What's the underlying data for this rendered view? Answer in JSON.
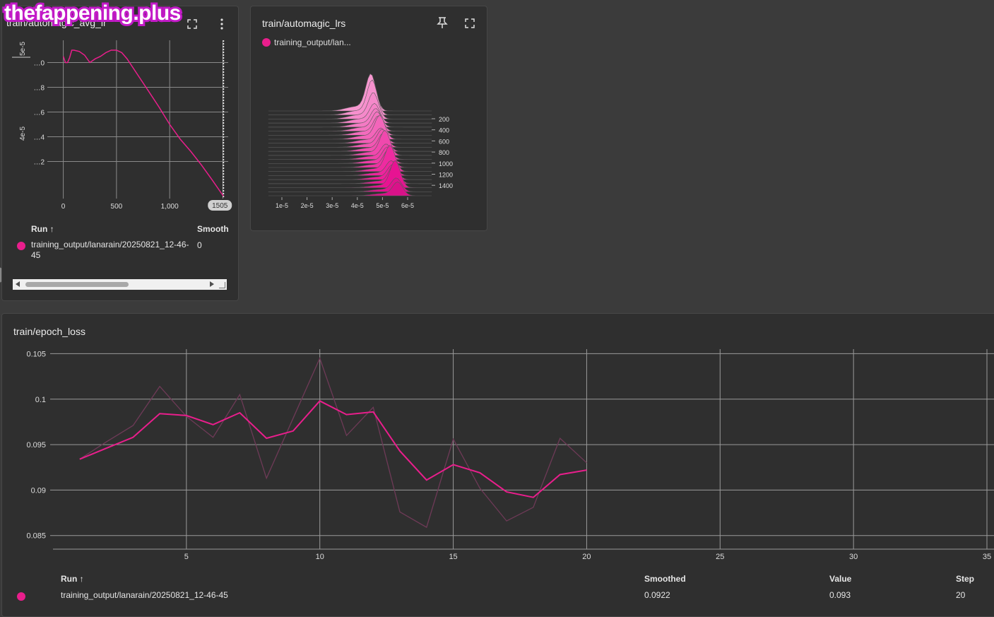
{
  "watermark": "thefappening.plus",
  "card1": {
    "title": "train/automagic_avg_lr",
    "y_exponent_top": "5e-5",
    "y_exponent_mid": "4e-5",
    "y_ticks": [
      "0",
      "8",
      "6",
      "4",
      "2"
    ],
    "x_ticks": [
      "0",
      "500",
      "1,000"
    ],
    "hover_step": "1505",
    "table": {
      "col_run": "Run ↑",
      "col_smoothed": "Smooth",
      "run_name": "training_output/lanarain/20250821_12-46-45",
      "smoothed": "0"
    }
  },
  "card2": {
    "title": "train/automagic_lrs",
    "legend": "training_output/lan...",
    "x_ticks": [
      "1e-5",
      "2e-5",
      "3e-5",
      "4e-5",
      "5e-5",
      "6e-5"
    ],
    "step_ticks": [
      "200",
      "400",
      "600",
      "800",
      "1000",
      "1200",
      "1400"
    ]
  },
  "card3": {
    "title": "train/epoch_loss",
    "table": {
      "col_run": "Run ↑",
      "col_smoothed": "Smoothed",
      "col_value": "Value",
      "col_step": "Step",
      "run_name": "training_output/lanarain/20250821_12-46-45",
      "smoothed": "0.0922",
      "value": "0.093",
      "step": "20"
    }
  },
  "colors": {
    "accent": "#e91e8c",
    "card_bg": "#2f2f2f",
    "page_bg": "#3b3b3b"
  },
  "chart_data": [
    {
      "type": "line",
      "title": "train/automagic_avg_lr",
      "x": [
        0,
        20,
        40,
        60,
        80,
        100,
        150,
        200,
        250,
        300,
        350,
        400,
        450,
        500,
        550,
        600,
        700,
        800,
        900,
        1000,
        1100,
        1200,
        1300,
        1400,
        1505
      ],
      "series": [
        {
          "values": [
            5.05e-05,
            5e-05,
            5e-05,
            5.04e-05,
            5.1e-05,
            5.1e-05,
            5.09e-05,
            5.06e-05,
            5e-05,
            5.03e-05,
            5.05e-05,
            5.08e-05,
            5.1e-05,
            5.1e-05,
            5.08e-05,
            5.03e-05,
            4.9e-05,
            4.77e-05,
            4.64e-05,
            4.5e-05,
            4.38e-05,
            4.28e-05,
            4.17e-05,
            4.05e-05,
            3.92e-05
          ]
        }
      ],
      "xlim": [
        -150,
        1550
      ],
      "ylim": [
        3.9e-05,
        5.18e-05
      ]
    },
    {
      "type": "area",
      "title": "train/automagic_lrs",
      "x_ticks": [
        "1e-5",
        "2e-5",
        "3e-5",
        "4e-5",
        "5e-5",
        "6e-5"
      ],
      "steps": [
        200,
        400,
        600,
        800,
        1000,
        1200,
        1400
      ]
    },
    {
      "type": "line",
      "title": "train/epoch_loss",
      "x": [
        1,
        2,
        3,
        4,
        5,
        6,
        7,
        8,
        9,
        10,
        11,
        12,
        13,
        14,
        15,
        16,
        17,
        18,
        19,
        20
      ],
      "series": [
        {
          "name": "Smoothed",
          "values": [
            0.0934,
            0.0946,
            0.0958,
            0.0984,
            0.0982,
            0.0972,
            0.0985,
            0.0957,
            0.0965,
            0.0998,
            0.0983,
            0.0986,
            0.0943,
            0.0911,
            0.0928,
            0.0919,
            0.0898,
            0.0892,
            0.0917,
            0.0922
          ]
        },
        {
          "name": "Value",
          "values": [
            0.0934,
            0.0953,
            0.0971,
            0.1014,
            0.0981,
            0.0958,
            0.1005,
            0.0913,
            0.0979,
            0.1045,
            0.096,
            0.0991,
            0.0876,
            0.0859,
            0.0956,
            0.0902,
            0.0866,
            0.0881,
            0.0957,
            0.093
          ]
        }
      ],
      "x_ticks": [
        5,
        10,
        15,
        20,
        25,
        30,
        35
      ],
      "y_ticks": [
        0.085,
        0.09,
        0.095,
        0.1,
        0.105
      ],
      "xlim": [
        0,
        35
      ],
      "ylim": [
        0.0835,
        0.1055
      ]
    }
  ]
}
